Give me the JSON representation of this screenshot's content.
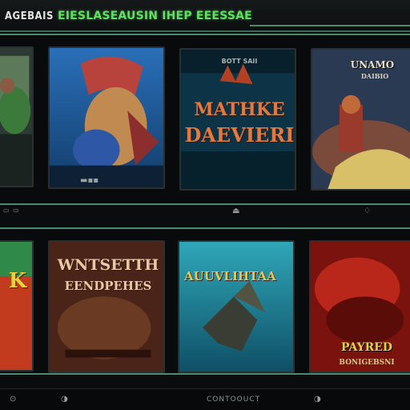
{
  "header": {
    "brand": "AGEBAIS",
    "headline": "EIESLASEAUSIN IHEP EEESSAE"
  },
  "colors": {
    "accent_green": "#5fe060",
    "frame_teal": "#4d8a6e",
    "title_orange": "#e27a3f"
  },
  "cards": [
    {
      "id": "c1",
      "icons": [
        "gamepad-icon"
      ]
    },
    {
      "id": "c2",
      "icons": [
        "gamepad-icon"
      ]
    },
    {
      "id": "c3",
      "subtitle": "BOTT SAII",
      "title_line1": "MATHKE",
      "title_line2": "DAEVIERI"
    },
    {
      "id": "c4",
      "title_line1": "UNAMO",
      "title_line2": "DAIBIO"
    },
    {
      "id": "c5",
      "letter": "K"
    },
    {
      "id": "c6",
      "title_line1": "WNTSETTH",
      "title_line2": "EENDPEHES"
    },
    {
      "id": "c7",
      "title": "AUUVLIHTAA"
    },
    {
      "id": "c8",
      "title": "PAYRED",
      "subtitle": "BONIGEBSNI"
    }
  ],
  "footer": {
    "center": "CONTOOUCT"
  }
}
